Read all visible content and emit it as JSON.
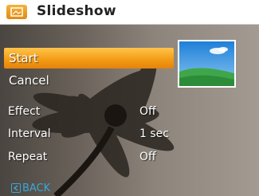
{
  "header": {
    "icon": "slideshow-icon",
    "title": "Slideshow"
  },
  "menu": {
    "items": [
      {
        "label": "Start",
        "selected": true
      },
      {
        "label": "Cancel",
        "selected": false
      }
    ]
  },
  "preview": {
    "icon": "landscape-thumbnail-icon"
  },
  "settings": [
    {
      "label": "Effect",
      "value": "Off"
    },
    {
      "label": "Interval",
      "value": "1 sec"
    },
    {
      "label": "Repeat",
      "value": "Off"
    }
  ],
  "footer": {
    "icon": "back-arrow-icon",
    "back_label": "BACK"
  },
  "colors": {
    "accent": "#f29a14",
    "back": "#3aa6d8",
    "text": "#ffffff"
  }
}
